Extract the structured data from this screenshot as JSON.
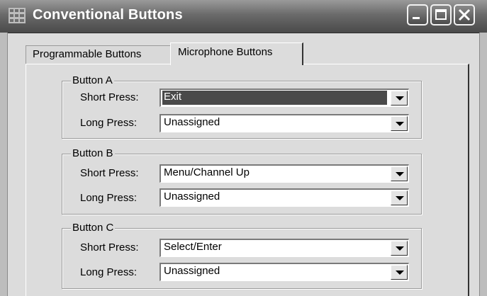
{
  "window": {
    "title": "Conventional Buttons",
    "icon": "grid-app-icon",
    "controls": [
      "minimize-icon",
      "maximize-icon",
      "close-icon"
    ]
  },
  "tabs": [
    {
      "label": "Programmable Buttons",
      "active": false
    },
    {
      "label": "Microphone Buttons",
      "active": true
    }
  ],
  "groups": [
    {
      "legend": "Button A",
      "rows": [
        {
          "label": "Short Press:",
          "value": "Exit",
          "selected": true
        },
        {
          "label": "Long Press:",
          "value": "Unassigned",
          "selected": false
        }
      ]
    },
    {
      "legend": "Button B",
      "rows": [
        {
          "label": "Short Press:",
          "value": "Menu/Channel Up",
          "selected": false
        },
        {
          "label": "Long Press:",
          "value": "Unassigned",
          "selected": false
        }
      ]
    },
    {
      "legend": "Button C",
      "rows": [
        {
          "label": "Short Press:",
          "value": "Select/Enter",
          "selected": false
        },
        {
          "label": "Long Press:",
          "value": "Unassigned",
          "selected": false
        }
      ]
    }
  ],
  "colors": {
    "titlebar": "#6a6a6a",
    "dialog_bg": "#dcdcdc",
    "selection": "#4a4a4a"
  }
}
